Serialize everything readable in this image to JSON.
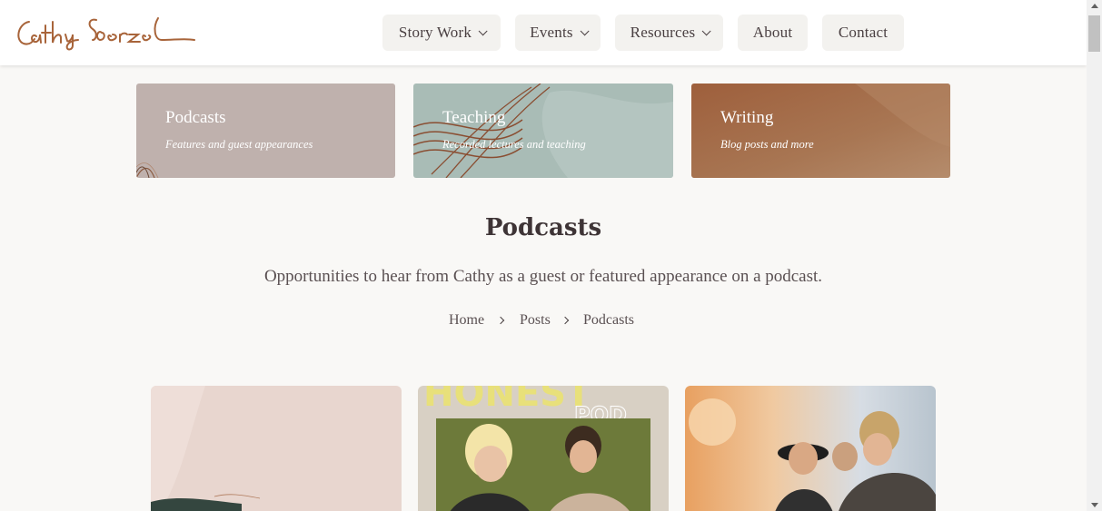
{
  "header": {
    "logo_text": "Cathy Loerzel",
    "nav": [
      {
        "label": "Story Work",
        "has_dropdown": true
      },
      {
        "label": "Events",
        "has_dropdown": true
      },
      {
        "label": "Resources",
        "has_dropdown": true
      },
      {
        "label": "About",
        "has_dropdown": false
      },
      {
        "label": "Contact",
        "has_dropdown": false
      }
    ]
  },
  "categories": [
    {
      "title": "Podcasts",
      "subtitle": "Features and guest appearances",
      "color": "#bfb1ad"
    },
    {
      "title": "Teaching",
      "subtitle": "Recorded lectures and teaching",
      "color": "#a9bcb6"
    },
    {
      "title": "Writing",
      "subtitle": "Blog posts and more",
      "color": "#a66e4d"
    }
  ],
  "page": {
    "title": "Podcasts",
    "description": "Opportunities to hear from Cathy as a guest or featured appearance on a podcast."
  },
  "breadcrumb": [
    "Home",
    "Posts",
    "Podcasts"
  ],
  "posts": [
    {
      "thumb_text": ""
    },
    {
      "thumb_text": "HONEST",
      "thumb_subtext": "POD"
    },
    {
      "thumb_text": ""
    }
  ],
  "colors": {
    "accent": "#a8643a",
    "background": "#f9f8f6",
    "text": "#4a4042"
  }
}
